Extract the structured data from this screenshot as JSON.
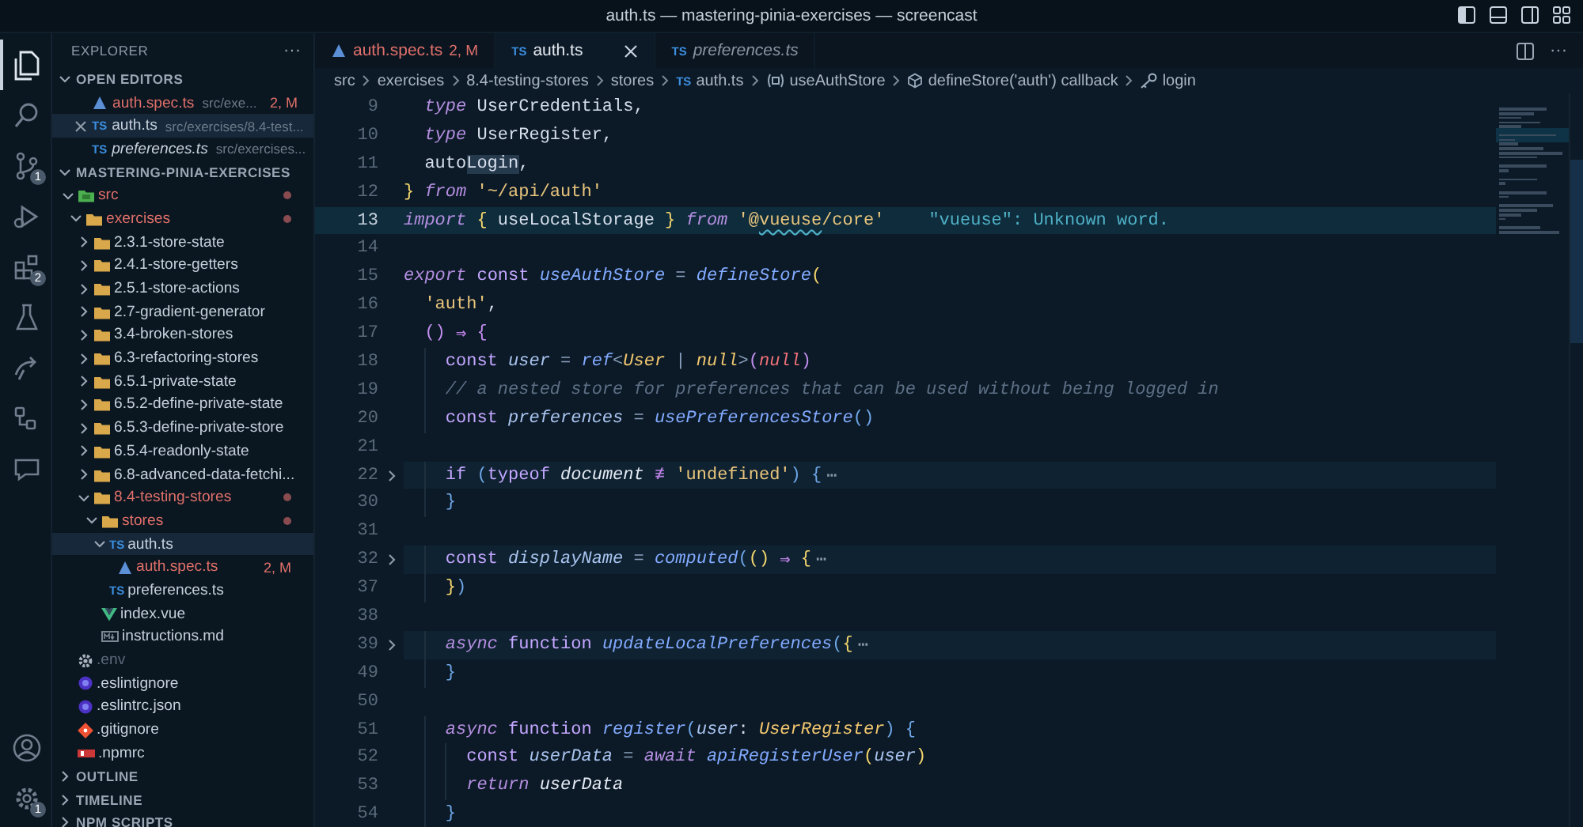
{
  "window": {
    "title": "auth.ts — mastering-pinia-exercises — screencast"
  },
  "activity_bar": {
    "items": [
      {
        "kind": "files",
        "selected": true
      },
      {
        "kind": "search",
        "selected": false
      },
      {
        "kind": "source-control",
        "selected": false,
        "badge": "1"
      },
      {
        "kind": "run",
        "selected": false
      },
      {
        "kind": "extensions",
        "selected": false,
        "badge": "2"
      },
      {
        "kind": "testing",
        "selected": false
      },
      {
        "kind": "remote",
        "selected": false
      },
      {
        "kind": "branches",
        "selected": false
      },
      {
        "kind": "chat",
        "selected": false
      }
    ],
    "bottom": [
      {
        "kind": "account",
        "selected": false
      },
      {
        "kind": "settings",
        "selected": false,
        "badge": "1"
      }
    ]
  },
  "sidebar": {
    "title": "EXPLORER",
    "more": "···",
    "open_editors": {
      "title": "OPEN EDITORS",
      "expanded": true,
      "items": [
        {
          "name": "auth.spec.ts",
          "kind": "spec",
          "description": "src/exe...",
          "badge": "2, M",
          "modified": true,
          "selected": false,
          "preview": false
        },
        {
          "name": "auth.ts",
          "kind": "ts",
          "icon_label": "TS",
          "description": "src/exercises/8.4-test...",
          "modified": false,
          "selected": true,
          "preview": false
        },
        {
          "name": "preferences.ts",
          "kind": "ts",
          "icon_label": "TS",
          "description": "src/exercises...",
          "modified": false,
          "selected": false,
          "preview": true
        }
      ]
    },
    "folder": {
      "title": "MASTERING-PINIA-EXERCISES",
      "expanded": true,
      "tree": [
        {
          "name": "src",
          "kind": "src-folder",
          "expanded": true,
          "modified": true,
          "selected": false,
          "children": [
            {
              "name": "exercises",
              "kind": "folder",
              "expanded": true,
              "modified": true,
              "selected": false,
              "children": [
                {
                  "name": "2.3.1-store-state",
                  "kind": "folder",
                  "expanded": false,
                  "modified": false,
                  "selected": false
                },
                {
                  "name": "2.4.1-store-getters",
                  "kind": "folder",
                  "expanded": false,
                  "modified": false,
                  "selected": false
                },
                {
                  "name": "2.5.1-store-actions",
                  "kind": "folder",
                  "expanded": false,
                  "modified": false,
                  "selected": false
                },
                {
                  "name": "2.7-gradient-generator",
                  "kind": "folder",
                  "expanded": false,
                  "modified": false,
                  "selected": false
                },
                {
                  "name": "3.4-broken-stores",
                  "kind": "folder",
                  "expanded": false,
                  "modified": false,
                  "selected": false
                },
                {
                  "name": "6.3-refactoring-stores",
                  "kind": "folder",
                  "expanded": false,
                  "modified": false,
                  "selected": false
                },
                {
                  "name": "6.5.1-private-state",
                  "kind": "folder",
                  "expanded": false,
                  "modified": false,
                  "selected": false
                },
                {
                  "name": "6.5.2-define-private-state",
                  "kind": "folder",
                  "expanded": false,
                  "modified": false,
                  "selected": false
                },
                {
                  "name": "6.5.3-define-private-store",
                  "kind": "folder",
                  "expanded": false,
                  "modified": false,
                  "selected": false
                },
                {
                  "name": "6.5.4-readonly-state",
                  "kind": "folder",
                  "expanded": false,
                  "modified": false,
                  "selected": false
                },
                {
                  "name": "6.8-advanced-data-fetchi...",
                  "kind": "folder",
                  "expanded": false,
                  "modified": false,
                  "selected": false
                },
                {
                  "name": "8.4-testing-stores",
                  "kind": "folder",
                  "expanded": true,
                  "modified": true,
                  "selected": false,
                  "children": [
                    {
                      "name": "stores",
                      "kind": "folder",
                      "expanded": true,
                      "modified": true,
                      "selected": false,
                      "children": [
                        {
                          "name": "auth.ts",
                          "kind": "ts",
                          "icon_label": "TS",
                          "expanded": true,
                          "modified": false,
                          "selected": true,
                          "children": [
                            {
                              "name": "auth.spec.ts",
                              "kind": "spec",
                              "badge": "2, M",
                              "modified": true,
                              "selected": false
                            }
                          ]
                        },
                        {
                          "name": "preferences.ts",
                          "kind": "ts",
                          "icon_label": "TS",
                          "modified": false,
                          "selected": false
                        }
                      ]
                    },
                    {
                      "name": "index.vue",
                      "kind": "vue",
                      "modified": false,
                      "selected": false
                    },
                    {
                      "name": "instructions.md",
                      "kind": "md",
                      "modified": false,
                      "selected": false
                    }
                  ]
                }
              ]
            }
          ]
        },
        {
          "name": ".env",
          "kind": "env",
          "dimmed": true,
          "modified": false,
          "selected": false
        },
        {
          "name": ".eslintignore",
          "kind": "eslint",
          "dimmed": false,
          "modified": false,
          "selected": false
        },
        {
          "name": ".eslintrc.json",
          "kind": "eslint",
          "dimmed": false,
          "modified": false,
          "selected": false
        },
        {
          "name": ".gitignore",
          "kind": "git",
          "dimmed": false,
          "modified": false,
          "selected": false
        },
        {
          "name": ".npmrc",
          "kind": "npm",
          "dimmed": false,
          "modified": false,
          "selected": false
        }
      ]
    },
    "sections": [
      {
        "title": "OUTLINE",
        "expanded": false
      },
      {
        "title": "TIMELINE",
        "expanded": false
      },
      {
        "title": "NPM SCRIPTS",
        "expanded": false
      }
    ]
  },
  "tabs": [
    {
      "label": "auth.spec.ts",
      "kind": "spec",
      "badge": "2, M",
      "modified": true,
      "selected": false,
      "preview": false
    },
    {
      "label": "auth.ts",
      "kind": "ts",
      "icon_label": "TS",
      "modified": false,
      "selected": true,
      "preview": false
    },
    {
      "label": "preferences.ts",
      "kind": "ts",
      "icon_label": "TS",
      "modified": false,
      "selected": false,
      "preview": true
    }
  ],
  "editor_actions": {
    "more": "···"
  },
  "breadcrumbs": [
    {
      "label": "src",
      "kind": "folder"
    },
    {
      "label": "exercises",
      "kind": "folder"
    },
    {
      "label": "8.4-testing-stores",
      "kind": "folder"
    },
    {
      "label": "stores",
      "kind": "folder"
    },
    {
      "label": "auth.ts",
      "kind": "ts",
      "icon_label": "TS"
    },
    {
      "label": "useAuthStore",
      "kind": "variable"
    },
    {
      "label": "defineStore('auth') callback",
      "kind": "method"
    },
    {
      "label": "login",
      "kind": "key"
    }
  ],
  "code": [
    {
      "number": "9",
      "folded": false,
      "current": false,
      "tokens": [
        {
          "t": "  type ",
          "kind": "kwi"
        },
        {
          "t": "UserCredentials,",
          "kind": "p"
        }
      ]
    },
    {
      "number": "10",
      "folded": false,
      "current": false,
      "tokens": [
        {
          "t": "  type ",
          "kind": "kwi"
        },
        {
          "t": "UserRegister,",
          "kind": "p"
        }
      ]
    },
    {
      "number": "11",
      "folded": false,
      "current": false,
      "tokens": [
        {
          "t": "  auto",
          "kind": "p"
        },
        {
          "t": "Login",
          "kind": "hl"
        },
        {
          "t": ",",
          "kind": "p"
        }
      ]
    },
    {
      "number": "12",
      "folded": false,
      "current": false,
      "tokens": [
        {
          "t": "}",
          "kind": "br"
        },
        {
          "t": " from ",
          "kind": "kwi"
        },
        {
          "t": "'~/api/auth'",
          "kind": "str"
        }
      ]
    },
    {
      "number": "13",
      "folded": false,
      "current": true,
      "diagnostic": "\"vueuse\": Unknown word.",
      "tokens": [
        {
          "t": "import ",
          "kind": "kwi"
        },
        {
          "t": "{",
          "kind": "br"
        },
        {
          "t": " useLocalStorage ",
          "kind": "p"
        },
        {
          "t": "}",
          "kind": "br"
        },
        {
          "t": " from ",
          "kind": "kwi"
        },
        {
          "t": "'@",
          "kind": "str"
        },
        {
          "t": "vueuse",
          "kind": "warn"
        },
        {
          "t": "/core'",
          "kind": "str"
        }
      ]
    },
    {
      "number": "14",
      "folded": false,
      "current": false
    },
    {
      "number": "15",
      "folded": false,
      "current": false,
      "tokens": [
        {
          "t": "export ",
          "kind": "kwi"
        },
        {
          "t": "const ",
          "kind": "kw"
        },
        {
          "t": "useAuthStore",
          "kind": "fn"
        },
        {
          "t": " = ",
          "kind": "op"
        },
        {
          "t": "defineStore",
          "kind": "fn"
        },
        {
          "t": "(",
          "kind": "br"
        }
      ]
    },
    {
      "number": "16",
      "folded": false,
      "current": false,
      "tokens": [
        {
          "t": "  'auth'",
          "kind": "str"
        },
        {
          "t": ",",
          "kind": "p"
        }
      ]
    },
    {
      "number": "17",
      "folded": false,
      "current": false,
      "tokens": [
        {
          "t": "  () ",
          "kind": "br2"
        },
        {
          "t": "⇒ ",
          "kind": "op2"
        },
        {
          "t": "{",
          "kind": "br2"
        }
      ]
    },
    {
      "number": "18",
      "folded": false,
      "current": false,
      "tokens": [
        {
          "t": "    const ",
          "kind": "kw"
        },
        {
          "t": "user",
          "kind": "var"
        },
        {
          "t": " = ",
          "kind": "op"
        },
        {
          "t": "ref",
          "kind": "fn"
        },
        {
          "t": "<",
          "kind": "op"
        },
        {
          "t": "User",
          "kind": "type"
        },
        {
          "t": " | ",
          "kind": "op"
        },
        {
          "t": "null",
          "kind": "type"
        },
        {
          "t": ">",
          "kind": "op"
        },
        {
          "t": "(",
          "kind": "br2"
        },
        {
          "t": "null",
          "kind": "null"
        },
        {
          "t": ")",
          "kind": "br2"
        }
      ]
    },
    {
      "number": "19",
      "folded": false,
      "current": false,
      "tokens": [
        {
          "t": "    // a nested store for preferences that can be used without being logged in",
          "kind": "cm"
        }
      ]
    },
    {
      "number": "20",
      "folded": false,
      "current": false,
      "tokens": [
        {
          "t": "    const ",
          "kind": "kw"
        },
        {
          "t": "preferences",
          "kind": "var"
        },
        {
          "t": " = ",
          "kind": "op"
        },
        {
          "t": "usePreferencesStore",
          "kind": "fn"
        },
        {
          "t": "()",
          "kind": "br3"
        }
      ]
    },
    {
      "number": "21",
      "folded": false,
      "current": false
    },
    {
      "number": "22",
      "folded": true,
      "current": false,
      "tokens": [
        {
          "t": "    if ",
          "kind": "kw"
        },
        {
          "t": "(",
          "kind": "br3"
        },
        {
          "t": "typeof ",
          "kind": "kw"
        },
        {
          "t": "document ",
          "kind": "var2"
        },
        {
          "t": "≢ ",
          "kind": "op2"
        },
        {
          "t": "'undefined'",
          "kind": "str"
        },
        {
          "t": ")",
          "kind": "br3"
        },
        {
          "t": " {",
          "kind": "br3"
        },
        {
          "t": "⋯",
          "kind": "fold"
        }
      ]
    },
    {
      "number": "30",
      "folded": false,
      "current": false,
      "tokens": [
        {
          "t": "    }",
          "kind": "br3"
        }
      ]
    },
    {
      "number": "31",
      "folded": false,
      "current": false
    },
    {
      "number": "32",
      "folded": true,
      "current": false,
      "tokens": [
        {
          "t": "    const ",
          "kind": "kw"
        },
        {
          "t": "displayName",
          "kind": "var"
        },
        {
          "t": " = ",
          "kind": "op"
        },
        {
          "t": "computed",
          "kind": "fn"
        },
        {
          "t": "(",
          "kind": "br3"
        },
        {
          "t": "()",
          "kind": "br"
        },
        {
          "t": " ⇒ ",
          "kind": "op2"
        },
        {
          "t": "{",
          "kind": "br"
        },
        {
          "t": "⋯",
          "kind": "fold"
        }
      ]
    },
    {
      "number": "37",
      "folded": false,
      "current": false,
      "tokens": [
        {
          "t": "    }",
          "kind": "br"
        },
        {
          "t": ")",
          "kind": "br3"
        }
      ]
    },
    {
      "number": "38",
      "folded": false,
      "current": false
    },
    {
      "number": "39",
      "folded": true,
      "current": false,
      "tokens": [
        {
          "t": "    async ",
          "kind": "kwi"
        },
        {
          "t": "function ",
          "kind": "kw"
        },
        {
          "t": "updateLocalPreferences",
          "kind": "fn"
        },
        {
          "t": "(",
          "kind": "br3"
        },
        {
          "t": "{",
          "kind": "br"
        },
        {
          "t": "⋯",
          "kind": "fold"
        }
      ]
    },
    {
      "number": "49",
      "folded": false,
      "current": false,
      "tokens": [
        {
          "t": "    }",
          "kind": "br3"
        }
      ]
    },
    {
      "number": "50",
      "folded": false,
      "current": false
    },
    {
      "number": "51",
      "folded": false,
      "current": false,
      "tokens": [
        {
          "t": "    async ",
          "kind": "kwi"
        },
        {
          "t": "function ",
          "kind": "kw"
        },
        {
          "t": "register",
          "kind": "fn"
        },
        {
          "t": "(",
          "kind": "br3"
        },
        {
          "t": "user",
          "kind": "var"
        },
        {
          "t": ": ",
          "kind": "p"
        },
        {
          "t": "UserRegister",
          "kind": "type"
        },
        {
          "t": ")",
          "kind": "br3"
        },
        {
          "t": " {",
          "kind": "br3"
        }
      ]
    },
    {
      "number": "52",
      "folded": false,
      "current": false,
      "tokens": [
        {
          "t": "      const ",
          "kind": "kw"
        },
        {
          "t": "userData",
          "kind": "var"
        },
        {
          "t": " = ",
          "kind": "op"
        },
        {
          "t": "await ",
          "kind": "kwi"
        },
        {
          "t": "apiRegisterUser",
          "kind": "fn"
        },
        {
          "t": "(",
          "kind": "br"
        },
        {
          "t": "user",
          "kind": "var"
        },
        {
          "t": ")",
          "kind": "br"
        }
      ]
    },
    {
      "number": "53",
      "folded": false,
      "current": false,
      "tokens": [
        {
          "t": "      return ",
          "kind": "kwi"
        },
        {
          "t": "userData",
          "kind": "var2"
        }
      ]
    },
    {
      "number": "54",
      "folded": false,
      "current": false,
      "tokens": [
        {
          "t": "    }",
          "kind": "br3"
        }
      ]
    }
  ]
}
